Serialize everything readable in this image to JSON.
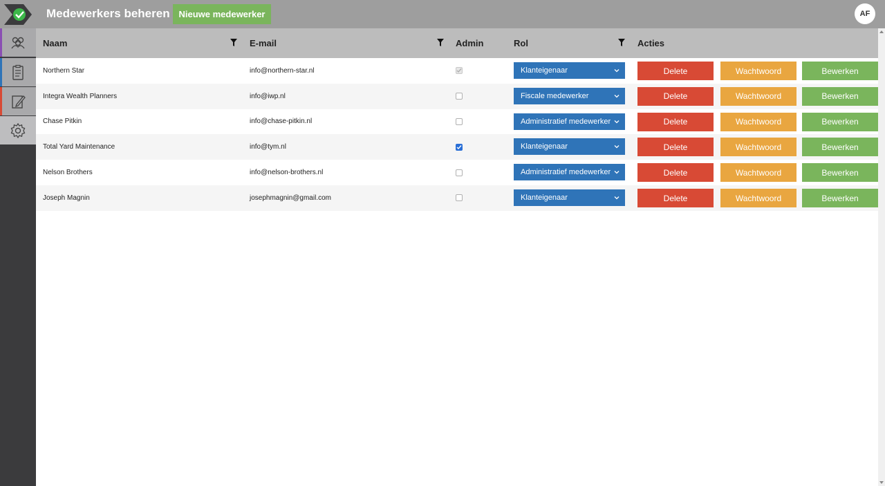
{
  "header": {
    "title": "Medewerkers beheren",
    "new_button": "Nieuwe medewerker",
    "avatar_initials": "AF"
  },
  "sidebar": {
    "items": [
      {
        "icon": "users-icon",
        "accent": "#8a4fb3"
      },
      {
        "icon": "clipboard-icon",
        "accent": "#2f74b8"
      },
      {
        "icon": "edit-icon",
        "accent": "#d84a35"
      },
      {
        "icon": "gear-icon",
        "accent": "#bdbdbf",
        "active": true
      }
    ]
  },
  "table": {
    "columns": {
      "name": "Naam",
      "email": "E-mail",
      "admin": "Admin",
      "role": "Rol",
      "actions": "Acties"
    },
    "action_labels": {
      "delete": "Delete",
      "password": "Wachtwoord",
      "edit": "Bewerken"
    },
    "rows": [
      {
        "name": "Northern Star",
        "email": "info@northern-star.nl",
        "admin": "checked-disabled",
        "role": "Klanteigenaar"
      },
      {
        "name": "Integra Wealth Planners",
        "email": "info@iwp.nl",
        "admin": "unchecked",
        "role": "Fiscale medewerker"
      },
      {
        "name": "Chase Pitkin",
        "email": "info@chase-pitkin.nl",
        "admin": "unchecked",
        "role": "Administratief medewerker"
      },
      {
        "name": "Total Yard Maintenance",
        "email": "info@tym.nl",
        "admin": "checked",
        "role": "Klanteigenaar"
      },
      {
        "name": "Nelson Brothers",
        "email": "info@nelson-brothers.nl",
        "admin": "unchecked",
        "role": "Administratief medewerker"
      },
      {
        "name": "Joseph Magnin",
        "email": "josephmagnin@gmail.com",
        "admin": "unchecked",
        "role": "Klanteigenaar"
      }
    ]
  },
  "colors": {
    "delete": "#d84a35",
    "password": "#e9a640",
    "edit": "#7ab55c",
    "role": "#2f74b8"
  }
}
